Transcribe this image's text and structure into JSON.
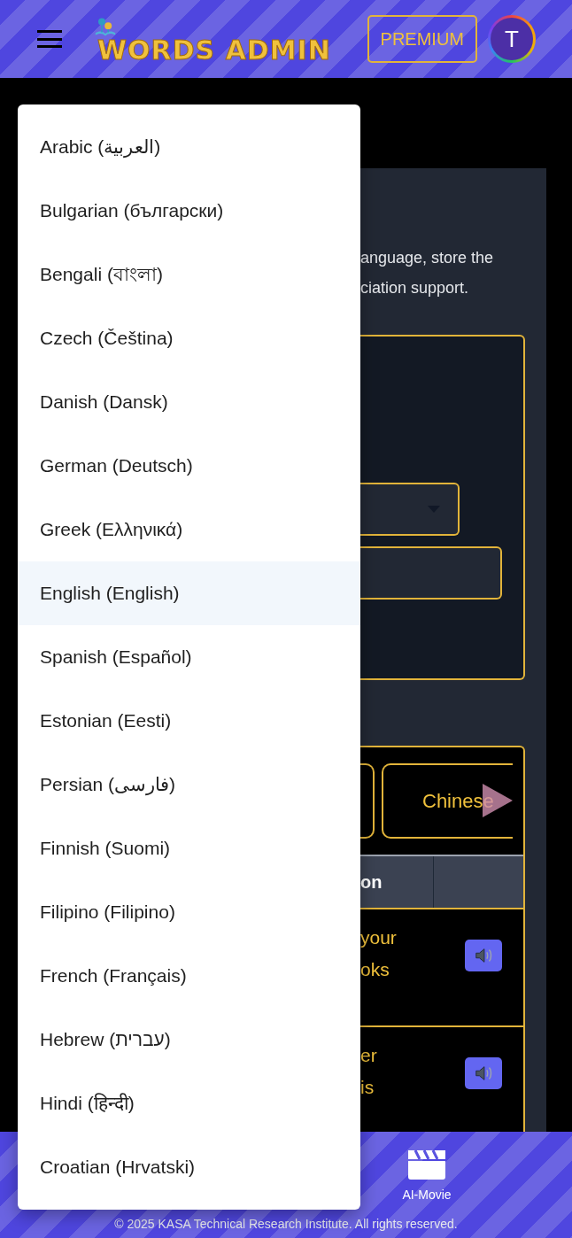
{
  "header": {
    "logo": "WORDS ADMIN",
    "premium_button": "PREMIUM",
    "avatar": "T"
  },
  "intro_lines": [
    "anguage, store the",
    "ciation support."
  ],
  "language_tabs": [
    {
      "label": "Chinese"
    }
  ],
  "table": {
    "header": "on",
    "rows": [
      {
        "lines": [
          "your",
          "oks"
        ]
      },
      {
        "lines": [
          "er",
          "is"
        ]
      }
    ]
  },
  "footer_nav": [
    {
      "label": "AI-Movie"
    }
  ],
  "copyright": "© 2025 KASA Technical Research Institute. All rights reserved.",
  "language_menu": {
    "items": [
      {
        "label": "Arabic (العربية)",
        "selected": false
      },
      {
        "label": "Bulgarian (български)",
        "selected": false
      },
      {
        "label": "Bengali (বাংলা)",
        "selected": false
      },
      {
        "label": "Czech (Čeština)",
        "selected": false
      },
      {
        "label": "Danish (Dansk)",
        "selected": false
      },
      {
        "label": "German (Deutsch)",
        "selected": false
      },
      {
        "label": "Greek (Ελληνικά)",
        "selected": false
      },
      {
        "label": "English (English)",
        "selected": true
      },
      {
        "label": "Spanish (Español)",
        "selected": false
      },
      {
        "label": "Estonian (Eesti)",
        "selected": false
      },
      {
        "label": "Persian (فارسی)",
        "selected": false
      },
      {
        "label": "Finnish (Suomi)",
        "selected": false
      },
      {
        "label": "Filipino (Filipino)",
        "selected": false
      },
      {
        "label": "French (Français)",
        "selected": false
      },
      {
        "label": "Hebrew (עברית)",
        "selected": false
      },
      {
        "label": "Hindi (हिन्दी)",
        "selected": false
      },
      {
        "label": "Croatian (Hrvatski)",
        "selected": false
      }
    ]
  }
}
